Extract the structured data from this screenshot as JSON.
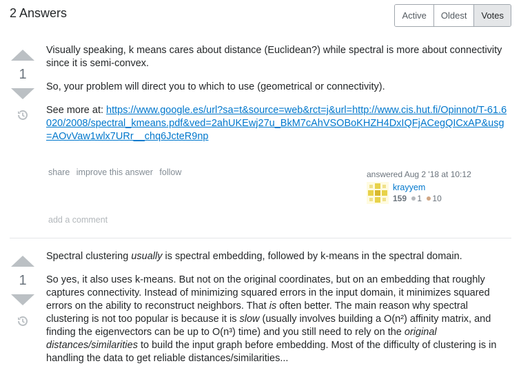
{
  "header": {
    "answers_count": "2 Answers",
    "tabs": [
      {
        "label": "Active"
      },
      {
        "label": "Oldest"
      },
      {
        "label": "Votes"
      }
    ]
  },
  "answers": [
    {
      "votes": "1",
      "paragraphs": [
        "Visually speaking, k means cares about distance (Euclidean?) while spectral is more about connectivity since it is semi-convex.",
        "So, your problem will direct you to which to use (geometrical or connectivity)."
      ],
      "see_more_prefix": "See more at: ",
      "see_more_link": "https://www.google.es/url?sa=t&source=web&rct=j&url=http://www.cis.hut.fi/Opinnot/T-61.6020/2008/spectral_kmeans.pdf&ved=2ahUKEwj27u_BkM7cAhVSOBoKHZH4DxIQFjACegQICxAP&usg=AOvVaw1wlx7URr__chq6JcteR9np",
      "menu": {
        "share": "share",
        "improve": "improve this answer",
        "follow": "follow"
      },
      "signature": {
        "action": "answered Aug 2 '18 at 10:12",
        "user": "krayyem",
        "reputation": "159",
        "silver": "1",
        "bronze": "10"
      },
      "add_comment": "add a comment"
    },
    {
      "votes": "1",
      "p1_pre": "Spectral clustering ",
      "p1_em": "usually",
      "p1_post": " is spectral embedding, followed by k-means in the spectral domain.",
      "p2_a": "So yes, it also uses k-means. But not on the original coordinates, but on an embedding that roughly captures connectivity. Instead of minimizing squared errors in the input domain, it minimizes squared errors on the ability to reconstruct neighbors. That ",
      "p2_em1": "is",
      "p2_b": " often better. The main reason why spectral clustering is not too popular is because it is ",
      "p2_em2": "slow",
      "p2_c": " (usually involves building a O(n²) affinity matrix, and finding the eigenvectors can be up to O(n³) time) and you still need to rely on the ",
      "p2_em3": "original distances/similarities",
      "p2_d": " to build the input graph before embedding. Most of the difficulty of clustering is in handling the data to get reliable distances/similarities..."
    }
  ],
  "colors": {
    "link": "#0077cc",
    "arrow": "#bbc0c4",
    "silver": "#b4b8bc",
    "bronze": "#d1a684"
  }
}
